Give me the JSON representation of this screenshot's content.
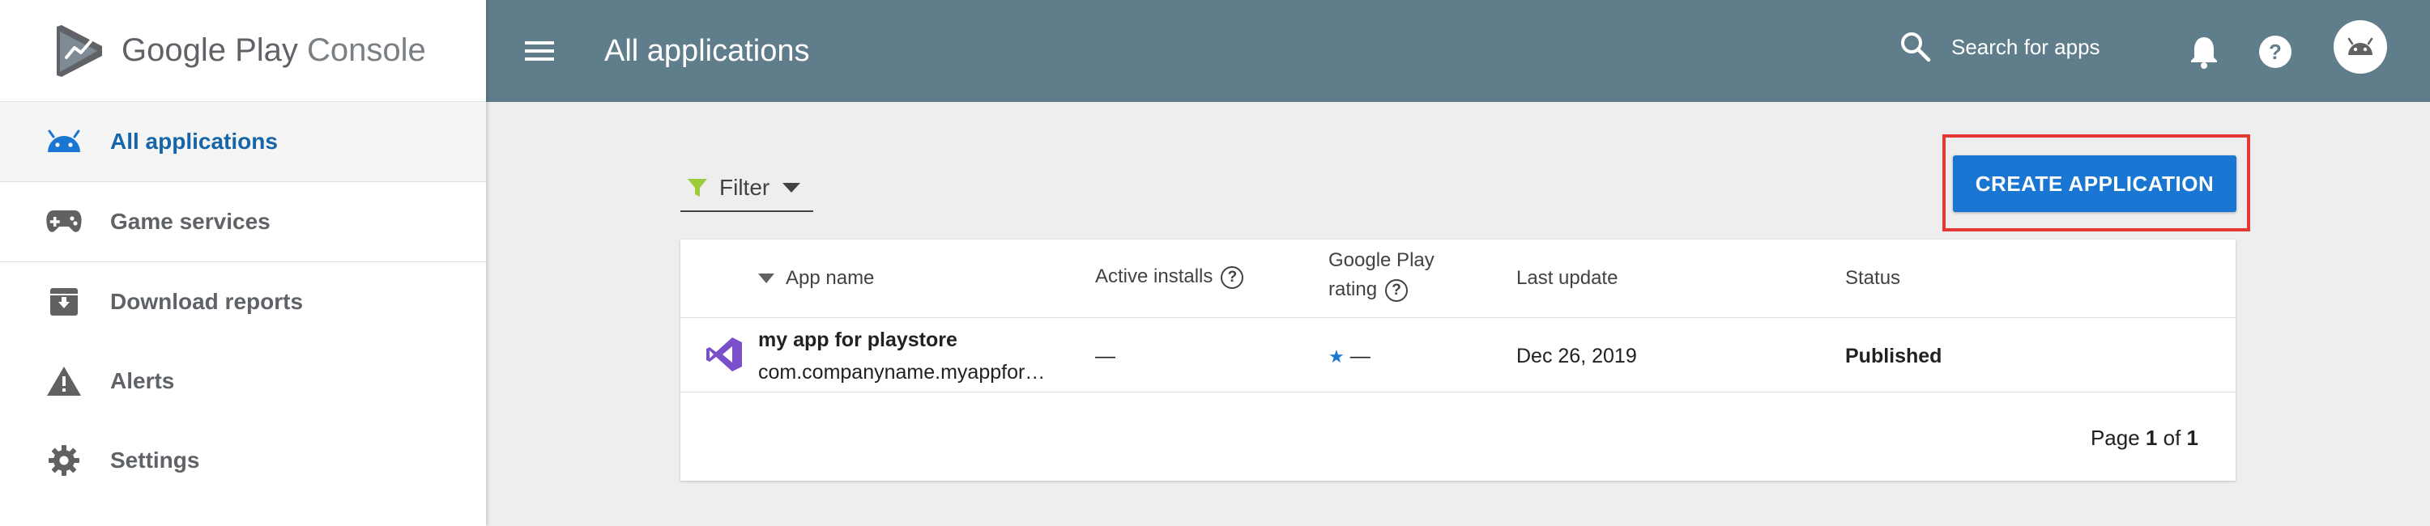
{
  "brand": {
    "name_main": "Google Play",
    "name_sub": "Console"
  },
  "sidebar": {
    "items": [
      {
        "label": "All applications",
        "icon": "android-icon",
        "active": true
      },
      {
        "label": "Game services",
        "icon": "gamepad-icon"
      },
      {
        "label": "Download reports",
        "icon": "archive-icon"
      },
      {
        "label": "Alerts",
        "icon": "warning-icon"
      },
      {
        "label": "Settings",
        "icon": "gear-icon"
      }
    ]
  },
  "header": {
    "title": "All applications",
    "search_placeholder": "Search for apps"
  },
  "toolbar": {
    "filter_label": "Filter",
    "create_label": "CREATE APPLICATION"
  },
  "table": {
    "columns": {
      "app_name": "App name",
      "active_installs": "Active installs",
      "rating_line1": "Google Play",
      "rating_line2": "rating",
      "last_update": "Last update",
      "status": "Status"
    },
    "rows": [
      {
        "name": "my app for playstore",
        "package": "com.companyname.myappfor…",
        "active_installs": "—",
        "rating_star": "★",
        "rating": "—",
        "last_update": "Dec 26, 2019",
        "status": "Published"
      }
    ]
  },
  "pagination": {
    "prefix": "Page",
    "current": "1",
    "of": "of",
    "total": "1"
  },
  "colors": {
    "header_bg": "#607d8b",
    "accent": "#1976d2",
    "active_nav_text": "#1565a8",
    "highlight": "#e53935",
    "filter_icon": "#9ccc3c",
    "app_icon": "#7b4fc9"
  }
}
